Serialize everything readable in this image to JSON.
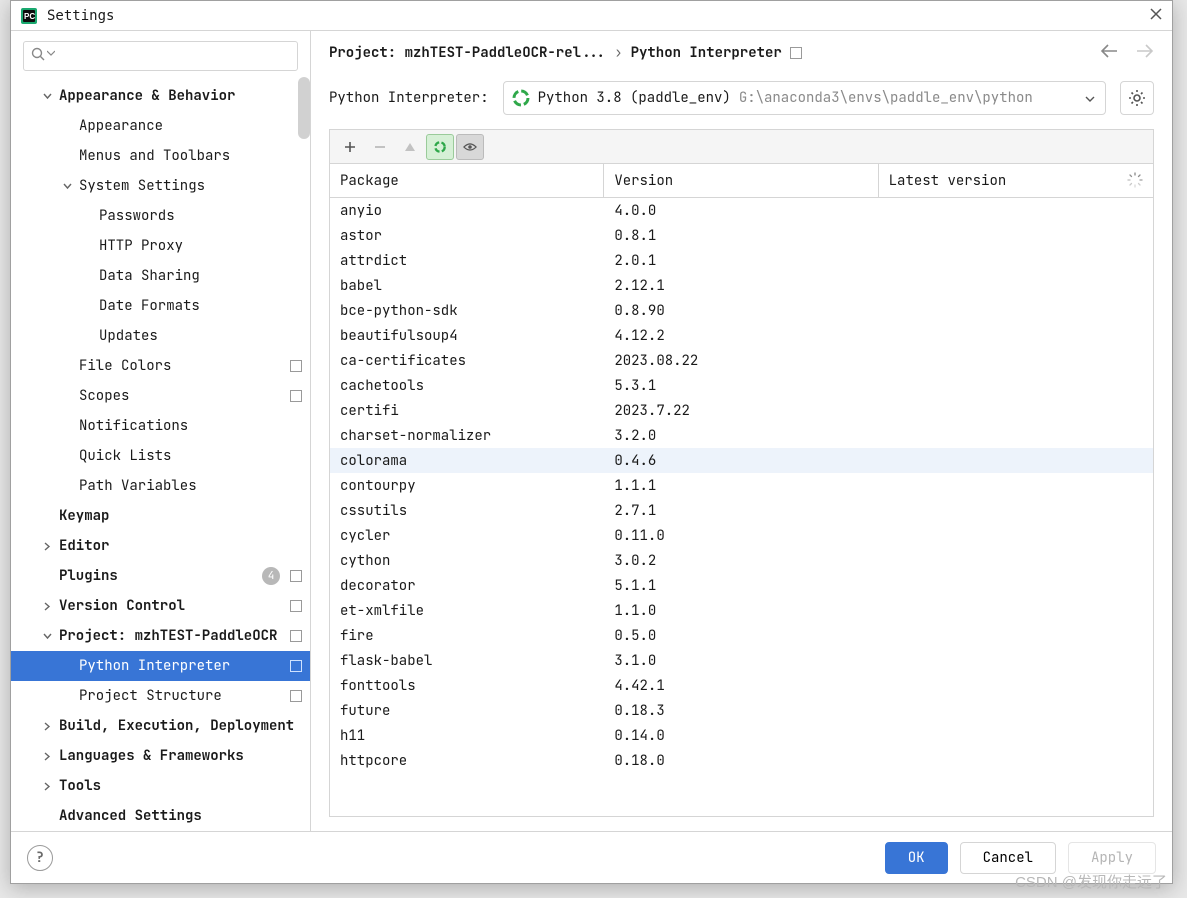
{
  "window": {
    "title": "Settings"
  },
  "search": {
    "placeholder": ""
  },
  "sidebar": {
    "items": [
      {
        "label": "Appearance & Behavior",
        "bold": true,
        "indent": 0,
        "arrow": "down"
      },
      {
        "label": "Appearance",
        "indent": 1
      },
      {
        "label": "Menus and Toolbars",
        "indent": 1
      },
      {
        "label": "System Settings",
        "indent": 1,
        "arrow": "down"
      },
      {
        "label": "Passwords",
        "indent": 2
      },
      {
        "label": "HTTP Proxy",
        "indent": 2
      },
      {
        "label": "Data Sharing",
        "indent": 2
      },
      {
        "label": "Date Formats",
        "indent": 2
      },
      {
        "label": "Updates",
        "indent": 2
      },
      {
        "label": "File Colors",
        "indent": 1,
        "trail": true
      },
      {
        "label": "Scopes",
        "indent": 1,
        "trail": true
      },
      {
        "label": "Notifications",
        "indent": 1
      },
      {
        "label": "Quick Lists",
        "indent": 1
      },
      {
        "label": "Path Variables",
        "indent": 1
      },
      {
        "label": "Keymap",
        "bold": true,
        "indent": 0
      },
      {
        "label": "Editor",
        "bold": true,
        "indent": 0,
        "arrow": "right"
      },
      {
        "label": "Plugins",
        "bold": true,
        "indent": 0,
        "badge": "4",
        "trail": true
      },
      {
        "label": "Version Control",
        "bold": true,
        "indent": 0,
        "arrow": "right",
        "trail": true
      },
      {
        "label": "Project: mzhTEST-PaddleOCR",
        "bold": true,
        "indent": 0,
        "arrow": "down",
        "trail": true
      },
      {
        "label": "Python Interpreter",
        "indent": 1,
        "selected": true,
        "trail": true
      },
      {
        "label": "Project Structure",
        "indent": 1,
        "trail": true
      },
      {
        "label": "Build, Execution, Deployment",
        "bold": true,
        "indent": 0,
        "arrow": "right"
      },
      {
        "label": "Languages & Frameworks",
        "bold": true,
        "indent": 0,
        "arrow": "right"
      },
      {
        "label": "Tools",
        "bold": true,
        "indent": 0,
        "arrow": "right"
      },
      {
        "label": "Advanced Settings",
        "bold": true,
        "indent": 0
      }
    ]
  },
  "breadcrumb": {
    "project": "Project: mzhTEST-PaddleOCR-rel...",
    "arrow": "›",
    "page": "Python Interpreter"
  },
  "interp": {
    "label": "Python Interpreter:",
    "name": "Python 3.8 (paddle_env)",
    "path": "G:\\anaconda3\\envs\\paddle_env\\python"
  },
  "table": {
    "headers": {
      "pkg": "Package",
      "ver": "Version",
      "latest": "Latest version"
    },
    "rows": [
      {
        "n": "anyio",
        "v": "4.0.0"
      },
      {
        "n": "astor",
        "v": "0.8.1"
      },
      {
        "n": "attrdict",
        "v": "2.0.1"
      },
      {
        "n": "babel",
        "v": "2.12.1"
      },
      {
        "n": "bce-python-sdk",
        "v": "0.8.90"
      },
      {
        "n": "beautifulsoup4",
        "v": "4.12.2"
      },
      {
        "n": "ca-certificates",
        "v": "2023.08.22"
      },
      {
        "n": "cachetools",
        "v": "5.3.1"
      },
      {
        "n": "certifi",
        "v": "2023.7.22"
      },
      {
        "n": "charset-normalizer",
        "v": "3.2.0"
      },
      {
        "n": "colorama",
        "v": "0.4.6",
        "hover": true
      },
      {
        "n": "contourpy",
        "v": "1.1.1"
      },
      {
        "n": "cssutils",
        "v": "2.7.1"
      },
      {
        "n": "cycler",
        "v": "0.11.0"
      },
      {
        "n": "cython",
        "v": "3.0.2"
      },
      {
        "n": "decorator",
        "v": "5.1.1"
      },
      {
        "n": "et-xmlfile",
        "v": "1.1.0"
      },
      {
        "n": "fire",
        "v": "0.5.0"
      },
      {
        "n": "flask-babel",
        "v": "3.1.0"
      },
      {
        "n": "fonttools",
        "v": "4.42.1"
      },
      {
        "n": "future",
        "v": "0.18.3"
      },
      {
        "n": "h11",
        "v": "0.14.0"
      },
      {
        "n": "httpcore",
        "v": "0.18.0"
      }
    ]
  },
  "footer": {
    "ok": "OK",
    "cancel": "Cancel",
    "apply": "Apply"
  },
  "watermark": "CSDN @发现你走远了"
}
